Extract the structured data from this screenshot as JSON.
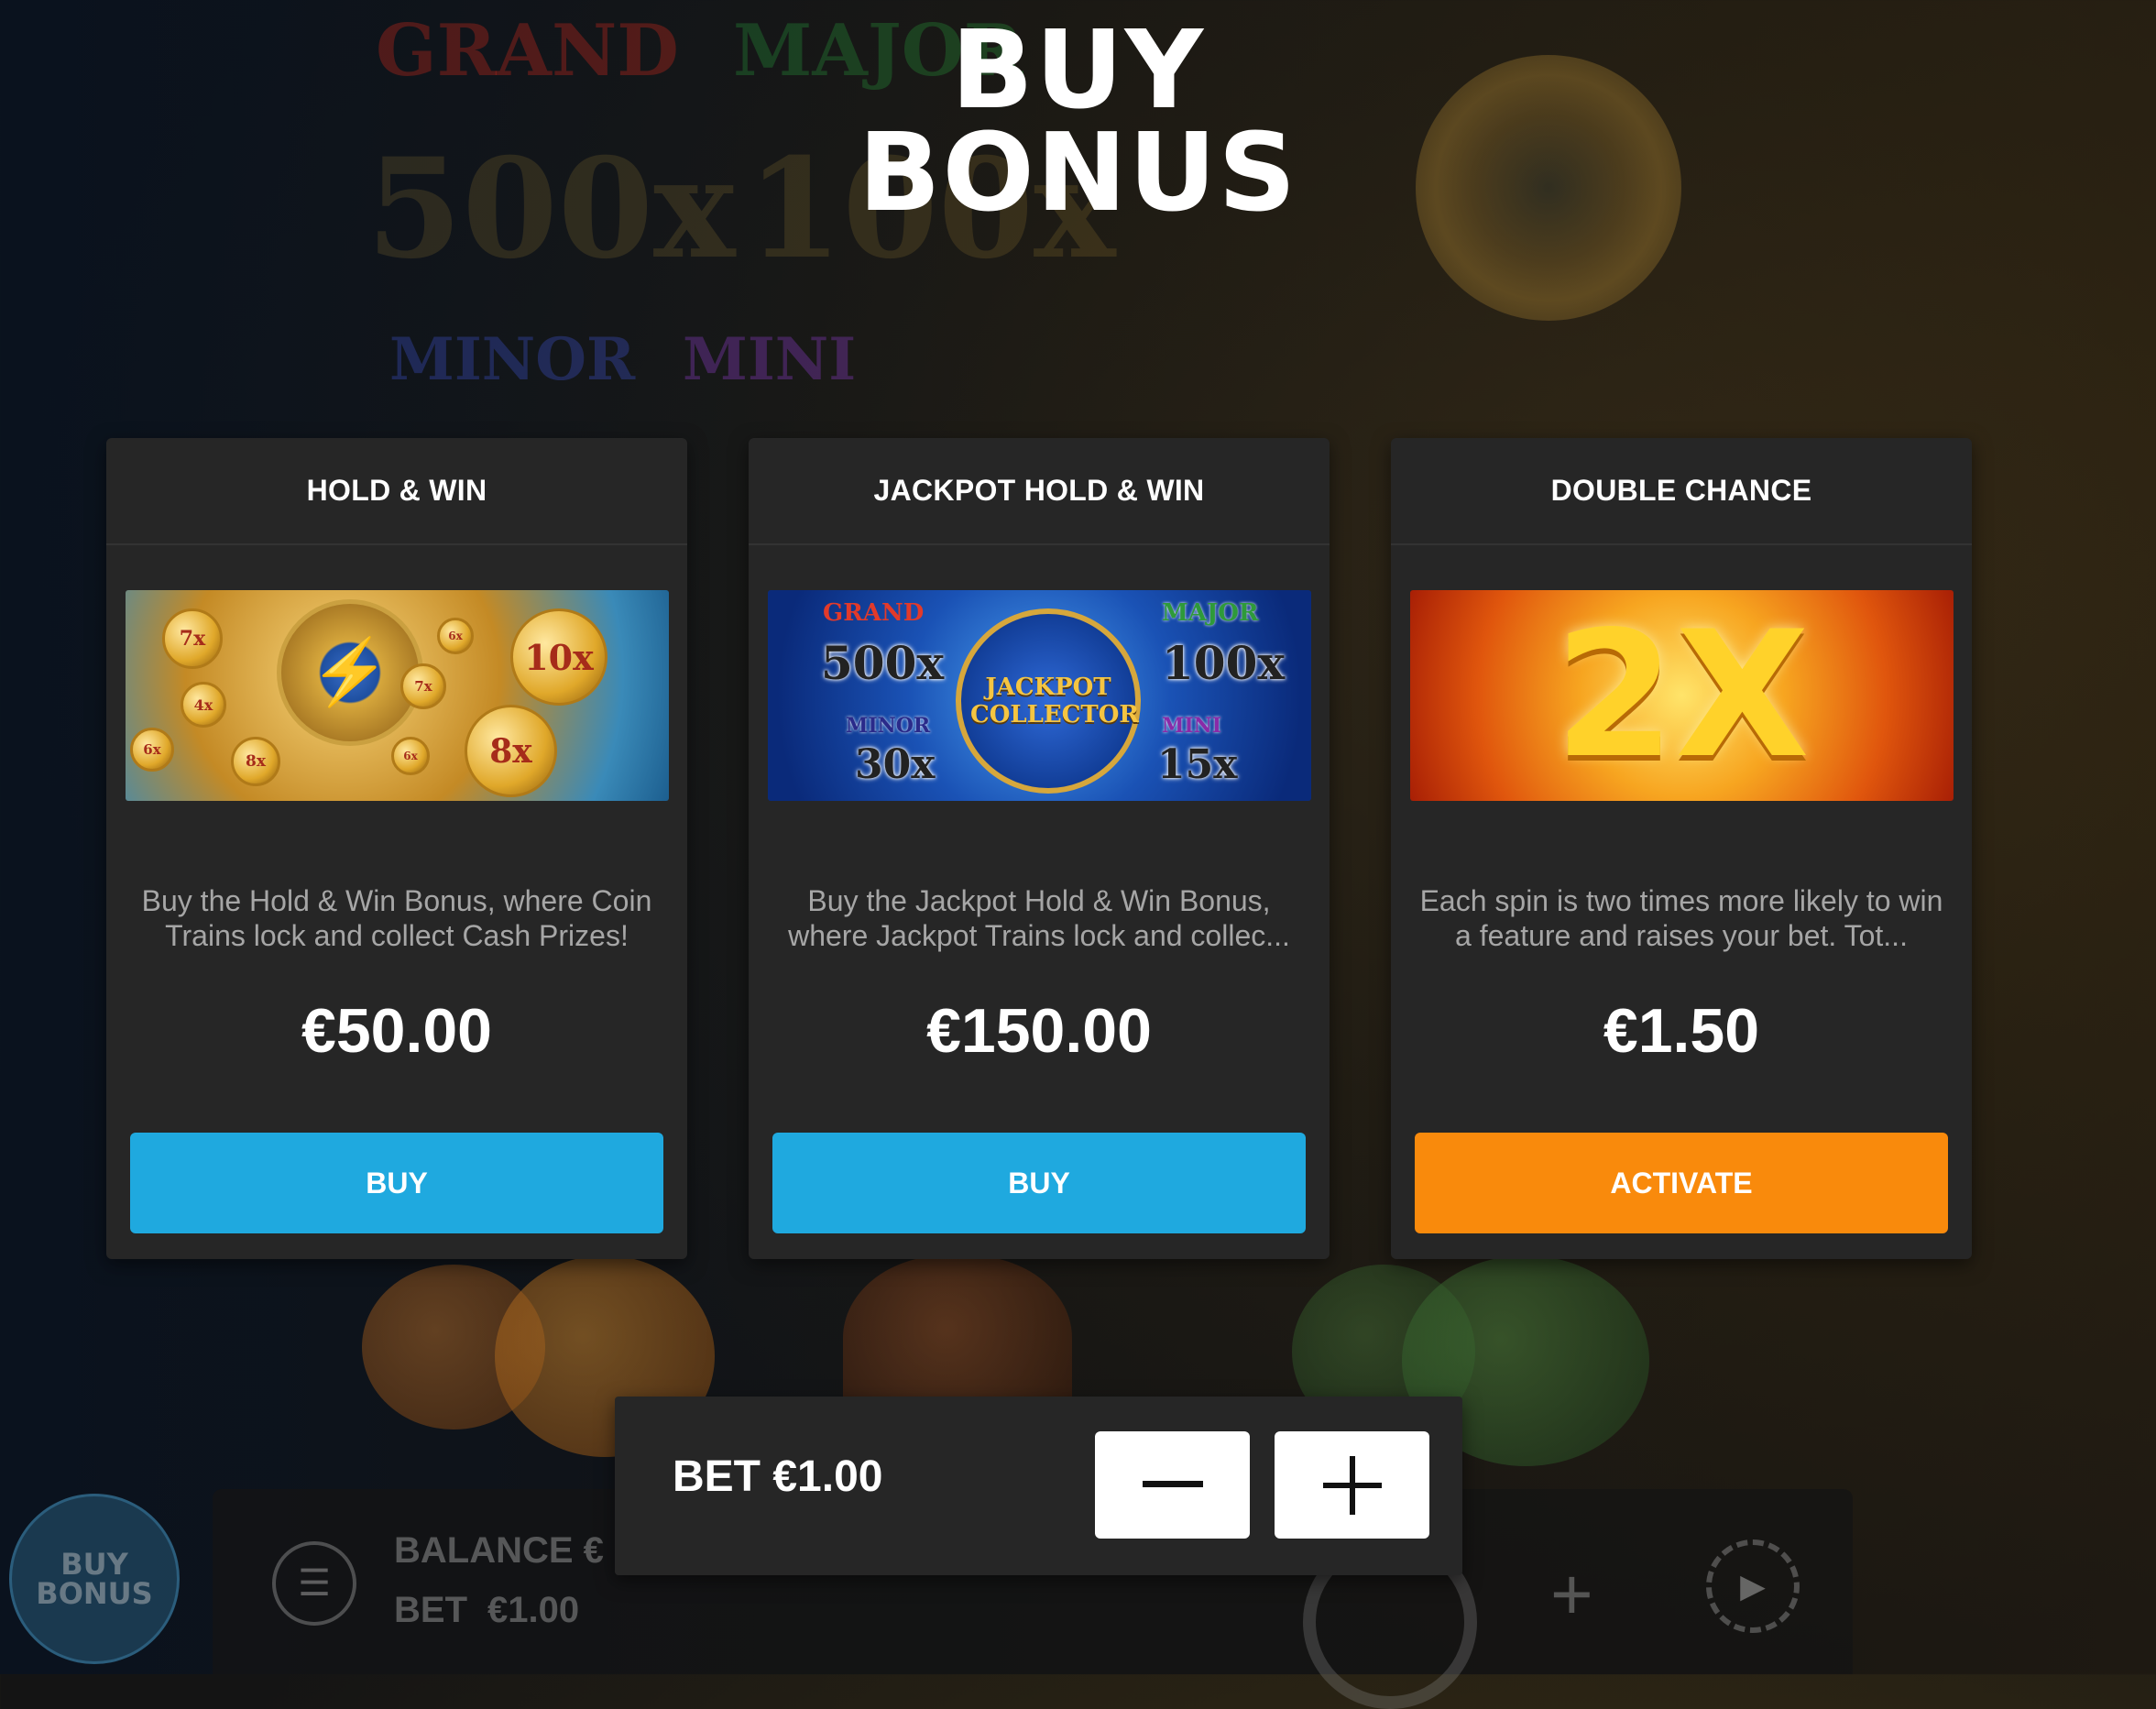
{
  "title": {
    "line1": "BUY",
    "line2": "BONUS"
  },
  "background": {
    "jackpots": [
      {
        "label": "GRAND",
        "value": "500x"
      },
      {
        "label": "MAJOR",
        "value": "100x"
      },
      {
        "label": "MINOR",
        "value": "30x"
      },
      {
        "label": "MINI",
        "value": "15x"
      }
    ]
  },
  "cards": [
    {
      "title": "HOLD & WIN",
      "description": "Buy the Hold & Win Bonus, where Coin Trains lock and collect Cash Prizes!",
      "price": "€50.00",
      "button": "BUY",
      "image_coins": [
        "7x",
        "4x",
        "6x",
        "8x",
        "10x",
        "7x",
        "6x",
        "8x",
        "6x"
      ]
    },
    {
      "title": "JACKPOT HOLD & WIN",
      "description": "Buy the Jackpot Hold & Win Bonus, where Jackpot Trains lock and collec...",
      "price": "€150.00",
      "button": "BUY",
      "image_labels": {
        "grand": "GRAND",
        "grand_value": "500x",
        "major": "MAJOR",
        "major_value": "100x",
        "minor": "MINOR",
        "minor_value": "30x",
        "mini": "MINI",
        "mini_value": "15x",
        "collector": "JACKPOT COLLECTOR"
      }
    },
    {
      "title": "DOUBLE CHANCE",
      "description": "Each spin is two times more likely to win a feature and raises your bet. Tot...",
      "price": "€1.50",
      "button": "ACTIVATE",
      "image_text": "2X"
    }
  ],
  "bet_panel": {
    "label": "BET €1.00",
    "minus_icon": "minus-icon",
    "plus_icon": "plus-icon"
  },
  "bottom_bar": {
    "buy_bonus_line1": "BUY",
    "buy_bonus_line2": "BONUS",
    "balance_label": "BALANCE €",
    "bet_label": "BET",
    "bet_value": "€1.00"
  },
  "colors": {
    "buy": "#1fa9df",
    "activate": "#f98a0c",
    "card_bg": "#262626"
  }
}
